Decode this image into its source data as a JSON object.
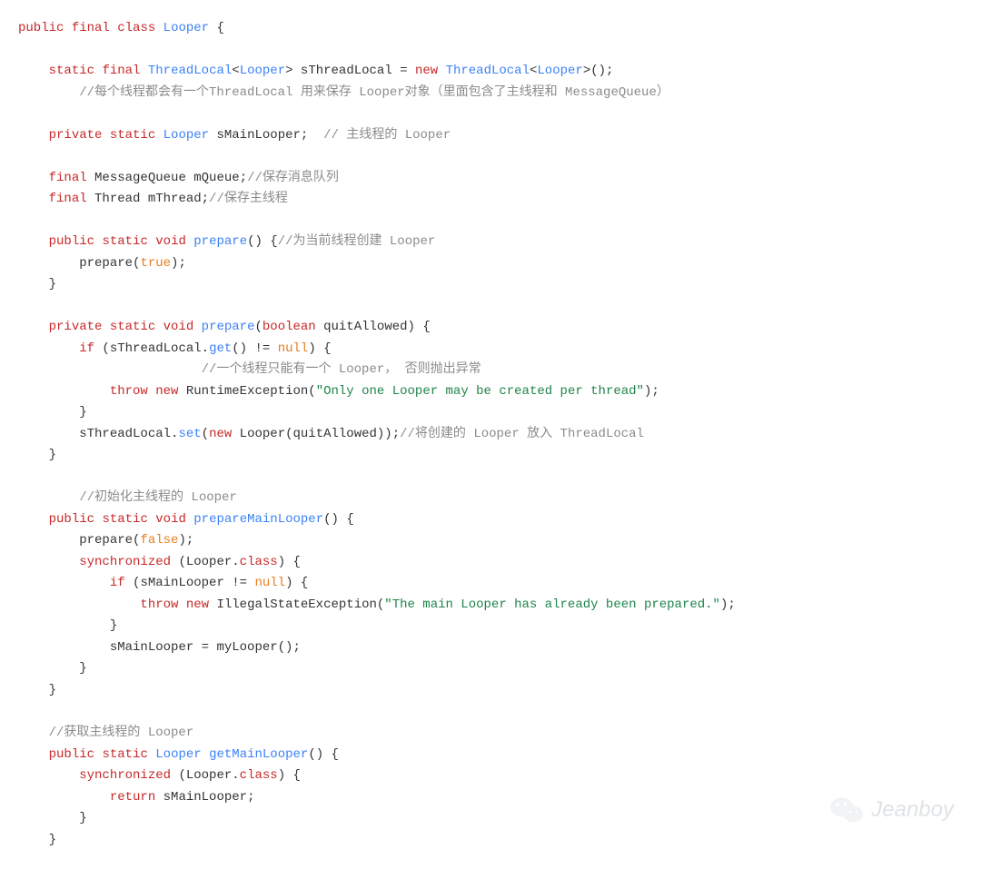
{
  "code": {
    "t": {
      "cls_decl_1": "public",
      "cls_decl_2": "final",
      "cls_decl_3": "class",
      "cls_decl_4": "Looper",
      "cls_decl_5": " {",
      "tl_1": "static",
      "tl_2": "final",
      "tl_3": "ThreadLocal",
      "tl_4": "<",
      "tl_5": "Looper",
      "tl_6": "> sThreadLocal = ",
      "tl_7": "new",
      "tl_8": "ThreadLocal",
      "tl_9": "<",
      "tl_10": "Looper",
      "tl_11": ">();",
      "tl_c": "//每个线程都会有一个ThreadLocal 用来保存 Looper对象（里面包含了主线程和 MessageQueue）",
      "ml_1": "private",
      "ml_2": "static",
      "ml_3": "Looper",
      "ml_4": " sMainLooper;  ",
      "ml_c": "// 主线程的 Looper",
      "mq_1": "final",
      "mq_2": " MessageQueue mQueue;",
      "mq_c": "//保存消息队列",
      "mt_1": "final",
      "mt_2": " Thread mThread;",
      "mt_c": "//保存主线程",
      "p1_1": "public",
      "p1_2": "static",
      "p1_3": "void",
      "p1_4": "prepare",
      "p1_5": "() {",
      "p1_c": "//为当前线程创建 Looper",
      "p1_6": "prepare(",
      "p1_7": "true",
      "p1_8": ");",
      "cb": "}",
      "p2_1": "private",
      "p2_2": "static",
      "p2_3": "void",
      "p2_4": "prepare",
      "p2_5": "(",
      "p2_6": "boolean",
      "p2_7": " quitAllowed) {",
      "p2_8": "if",
      "p2_9": " (sThreadLocal.",
      "p2_10": "get",
      "p2_11": "() != ",
      "p2_12": "null",
      "p2_13": ") {",
      "p2_c1": "//一个线程只能有一个 Looper， 否则抛出异常",
      "p2_14": "throw",
      "p2_15": "new",
      "p2_16": " RuntimeException(",
      "p2_17": "\"Only one Looper may be created per thread\"",
      "p2_18": ");",
      "p2_19": "sThreadLocal.",
      "p2_20": "set",
      "p2_21": "(",
      "p2_22": "new",
      "p2_23": " Looper(quitAllowed));",
      "p2_c2": "//将创建的 Looper 放入 ThreadLocal",
      "pm_c": "//初始化主线程的 Looper",
      "pm_1": "public",
      "pm_2": "static",
      "pm_3": "void",
      "pm_4": "prepareMainLooper",
      "pm_5": "() {",
      "pm_6": "prepare(",
      "pm_7": "false",
      "pm_8": ");",
      "pm_9": "synchronized",
      "pm_10": " (Looper.",
      "pm_11": "class",
      "pm_12": ") {",
      "pm_13": "if",
      "pm_14": " (sMainLooper != ",
      "pm_15": "null",
      "pm_16": ") {",
      "pm_17": "throw",
      "pm_18": "new",
      "pm_19": " IllegalStateException(",
      "pm_20": "\"The main Looper has already been prepared.\"",
      "pm_21": ");",
      "pm_22": "sMainLooper = myLooper();",
      "gm_c": "//获取主线程的 Looper",
      "gm_1": "public",
      "gm_2": "static",
      "gm_3": "Looper",
      "gm_4": "getMainLooper",
      "gm_5": "() {",
      "gm_6": "synchronized",
      "gm_7": " (Looper.",
      "gm_8": "class",
      "gm_9": ") {",
      "gm_10": "return",
      "gm_11": " sMainLooper;"
    }
  },
  "watermark": {
    "name": "Jeanboy"
  }
}
